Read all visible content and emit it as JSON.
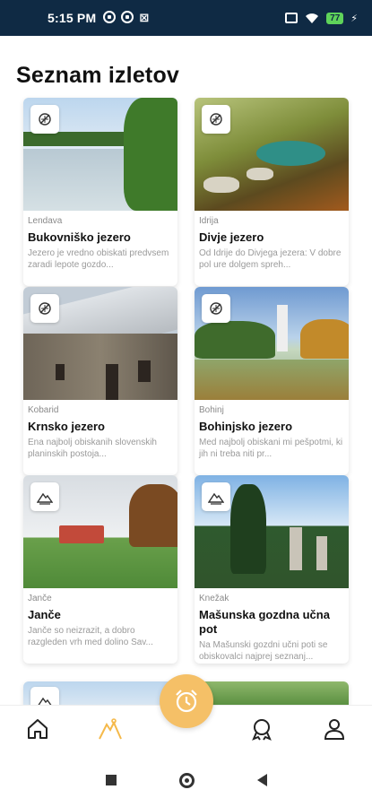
{
  "status_bar": {
    "time": "5:15 PM",
    "left_icons": [
      "notification-icon",
      "notification-icon",
      "mail-icon"
    ],
    "right_icons": [
      "screen-record-icon",
      "wifi-icon",
      "battery-icon"
    ],
    "battery_level": "77"
  },
  "page": {
    "title": "Seznam izletov"
  },
  "cards": [
    {
      "region": "Lendava",
      "name": "Bukovniško jezero",
      "description": "Jezero je vredno obiskati predvsem zaradi lepote gozdo...",
      "badge_icon": "hiking-icon"
    },
    {
      "region": "Idrija",
      "name": "Divje jezero",
      "description": "Od Idrije do Divjega jezera: V dobre pol ure dolgem spreh...",
      "badge_icon": "hiking-icon"
    },
    {
      "region": "Kobarid",
      "name": "Krnsko jezero",
      "description": "Ena najbolj obiskanih slovenskih planinskih postoja...",
      "badge_icon": "hiking-icon"
    },
    {
      "region": "Bohinj",
      "name": "Bohinjsko jezero",
      "description": "Med najbolj obiskani mi pešpotmi, ki jih ni treba niti pr...",
      "badge_icon": "hiking-icon"
    },
    {
      "region": "Janče",
      "name": "Janče",
      "description": "Janče so neizrazit, a dobro razgleden vrh med dolino Sav...",
      "badge_icon": "mountain-icon"
    },
    {
      "region": "Knežak",
      "name": "Mašunska gozdna učna pot",
      "description": "Na Mašunski gozdni učni poti se obiskovalci najprej seznanj...",
      "badge_icon": "mountain-icon"
    }
  ],
  "nav": {
    "items": [
      "home-icon",
      "trips-icon",
      "add-trip-icon",
      "awards-icon",
      "profile-icon"
    ],
    "accent_color": "#f5b94a"
  },
  "system_nav": [
    "recent-apps-icon",
    "home-button-icon",
    "back-icon"
  ]
}
